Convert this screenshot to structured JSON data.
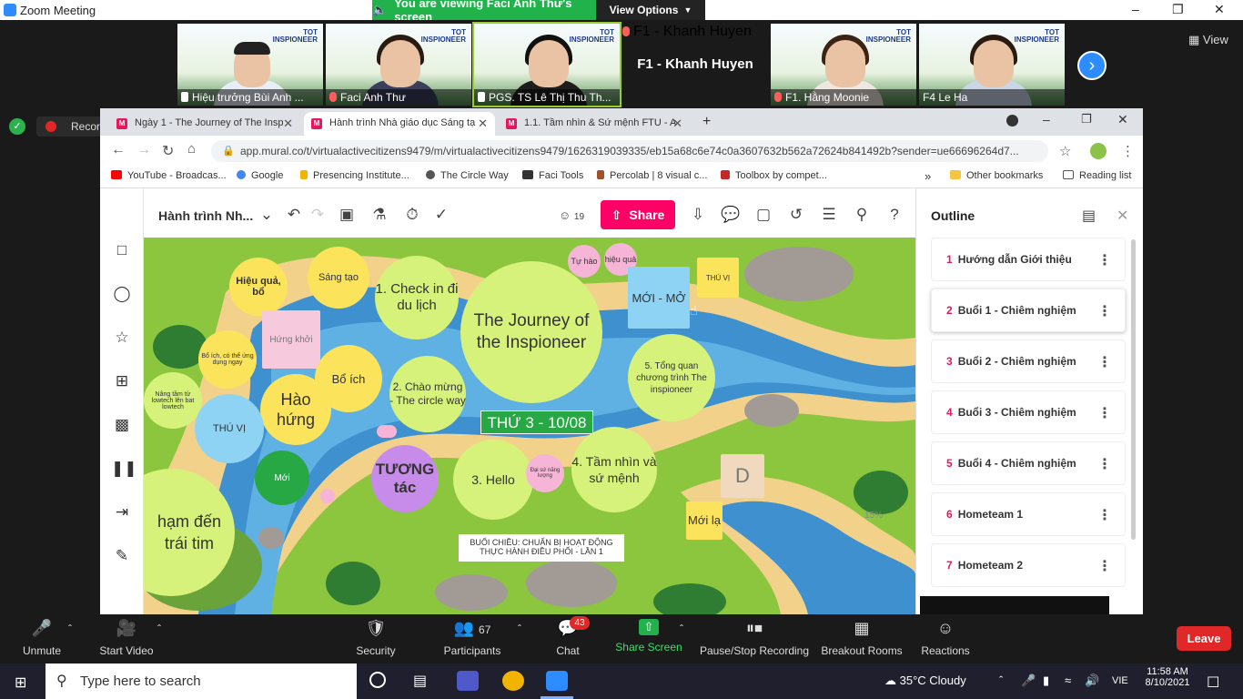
{
  "zoom": {
    "window_title": "Zoom Meeting",
    "banner": "You are viewing Faci Anh Thư's screen",
    "view_options": "View Options",
    "view": "View",
    "recording": "Recording...",
    "participants_tiles": [
      {
        "name": "Hiệu trưởng Bùi Anh ..."
      },
      {
        "name": "Faci Anh Thư"
      },
      {
        "name": "PGS. TS Lê Thị Thu Th..."
      },
      {
        "name": "F1 - Khanh Huyen"
      },
      {
        "name": "F1. Hằng Moonie"
      },
      {
        "name": "F4 Le Ha"
      }
    ],
    "khanh_big": "F1 - Khanh Huyen",
    "tile_logo": "TOT\nINSPIONEER",
    "bottom": {
      "unmute": "Unmute",
      "start_video": "Start Video",
      "security": "Security",
      "participants": "Participants",
      "participants_count": "67",
      "chat": "Chat",
      "chat_badge": "43",
      "share_screen": "Share Screen",
      "pause_recording": "Pause/Stop Recording",
      "breakout": "Breakout Rooms",
      "reactions": "Reactions",
      "leave": "Leave"
    }
  },
  "browser": {
    "tabs": [
      {
        "label": "Ngày 1 - The Journey of The Insp"
      },
      {
        "label": "Hành trình Nhà giáo dục Sáng tạ"
      },
      {
        "label": "1.1. Tầm nhìn & Sứ mệnh FTU - A"
      }
    ],
    "url": "app.mural.co/t/virtualactivecitizens9479/m/virtualactivecitizens9479/1626319039335/eb15a68c6e74c0a3607632b562a72624b841492b?sender=ue66696264d7...",
    "bookmarks": [
      "YouTube - Broadcas...",
      "Google",
      "Presencing Institute...",
      "The Circle Way",
      "Faci Tools",
      "Percolab | 8 visual c...",
      "Toolbox by compet..."
    ],
    "other_bookmarks": "Other bookmarks",
    "reading_list": "Reading list"
  },
  "mural": {
    "title": "Hành trình Nh...",
    "members": "19",
    "share": "Share",
    "outline_title": "Outline",
    "outline": [
      {
        "n": "1",
        "label": "Hướng dẫn Giới thiệu"
      },
      {
        "n": "2",
        "label": "Buổi 1 - Chiêm nghiệm"
      },
      {
        "n": "3",
        "label": "Buổi 2 - Chiêm nghiệm"
      },
      {
        "n": "4",
        "label": "Buổi 3 - Chiêm nghiệm"
      },
      {
        "n": "5",
        "label": "Buổi 4 - Chiêm nghiệm"
      },
      {
        "n": "6",
        "label": "Hometeam 1"
      },
      {
        "n": "7",
        "label": "Hometeam 2"
      }
    ],
    "canvas": {
      "hieu_qua_bo": "Hiệu quả, bổ",
      "sang_tao": "Sáng tạo",
      "check_in": "1. Check in đi du lịch",
      "journey": "The Journey of the Inspioneer",
      "tu_hao": "Tự hào",
      "hieu_qua": "hiệu quả",
      "moi_mo": "MỚI - MỞ",
      "thu_vi_small": "THÚ VỊ",
      "hung_khoi": "Hứng khởi",
      "bo_ich_co_the": "Bổ ích, có thể ứng dụng ngay",
      "bo_ich": "Bổ ích",
      "chao_mung": "2. Chào mừng - The circle way",
      "tong_quan": "5. Tổng quan chương trình The inspioneer",
      "nang_tam": "Nâng tầm từ lowtech lên bat lowtech",
      "hao_hung": "Hào hứng",
      "thu_vi": "THÚ VỊ",
      "thu3": "THỨ 3 - 10/08",
      "moi": "Mới",
      "tuong_tac": "TƯƠNG tác",
      "hello": "3. Hello",
      "dai_su": "Đại sứ năng lượng",
      "tam_nhin": "4. Tầm nhìn và sứ mệnh",
      "d": "D",
      "moi_la": "Mới lạ",
      "cham_den": "hạm đến trái tim",
      "buoi_chieu": "BUỔI CHIỀU: CHUẨN BỊ HOẠT ĐỘNG THỰC HÀNH ĐIỀU PHỐI - LẦN 1",
      "zoom_pct": "15%"
    }
  },
  "taskbar": {
    "search": "Type here to search",
    "weather": "35°C  Cloudy",
    "lang": "VIE",
    "time": "11:58 AM",
    "date": "8/10/2021"
  },
  "colors": {
    "zoom_green": "#21b24b",
    "mural_pink": "#ff0066",
    "leave_red": "#e02828",
    "zoom_blue": "#2d8cff"
  }
}
